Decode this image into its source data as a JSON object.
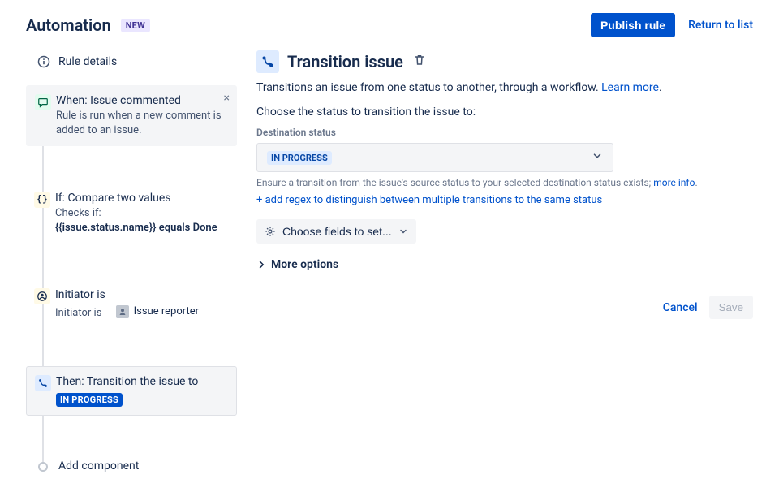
{
  "header": {
    "title": "Automation",
    "badge": "NEW",
    "publish_label": "Publish rule",
    "return_label": "Return to list"
  },
  "sidebar": {
    "rule_details_label": "Rule details",
    "steps": {
      "when": {
        "title": "When: Issue commented",
        "sub": "Rule is run when a new comment is added to an issue."
      },
      "if": {
        "title": "If: Compare two values",
        "sub_prefix": "Checks if:",
        "sub_expr": "{{issue.status.name}} equals Done"
      },
      "who": {
        "title": "Initiator is",
        "sub_prefix": "Initiator is",
        "chip": "Issue reporter"
      },
      "then": {
        "title": "Then: Transition the issue to",
        "status": "IN PROGRESS"
      }
    },
    "add_label": "Add component"
  },
  "panel": {
    "title": "Transition issue",
    "desc_text": "Transitions an issue from one status to another, through a workflow. ",
    "desc_link": "Learn more",
    "field_prompt": "Choose the status to transition the issue to:",
    "dest_label": "Destination status",
    "dest_value": "IN PROGRESS",
    "ensure_text": "Ensure a transition from the issue's source status to your selected destination status exists; ",
    "ensure_link": "more info",
    "add_regex": "+ add regex to distinguish between multiple transitions to the same status",
    "choose_fields": "Choose fields to set...",
    "more_options": "More options",
    "cancel": "Cancel",
    "save": "Save"
  }
}
